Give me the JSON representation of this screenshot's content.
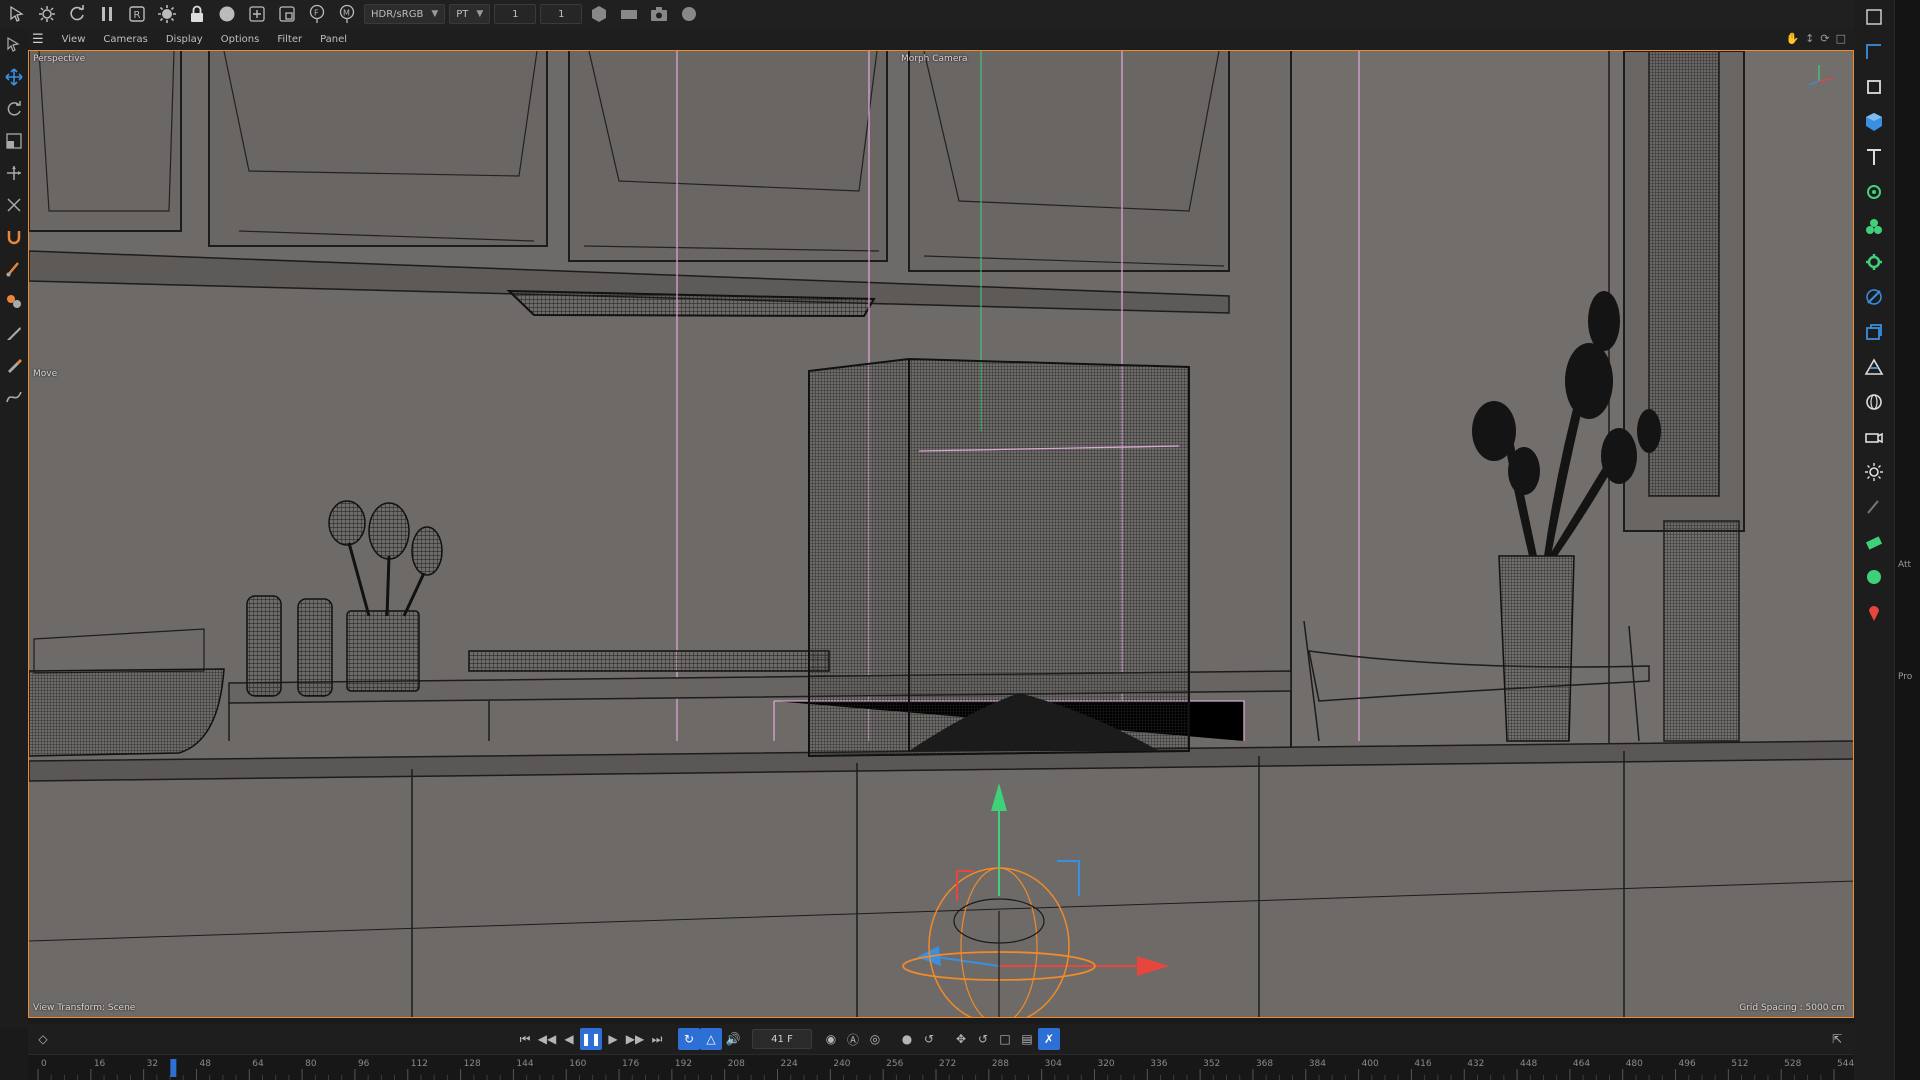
{
  "toolbar": {
    "color_space": "HDR/sRGB",
    "render_mode": "PT",
    "field_a": "1",
    "field_b": "1"
  },
  "viewport_menu": {
    "items": [
      "View",
      "Cameras",
      "Display",
      "Options",
      "Filter",
      "Panel"
    ]
  },
  "viewport": {
    "camera_label": "Perspective",
    "active_camera": "Morph Camera",
    "tool_label": "Move",
    "view_transform": "View Transform: Scene",
    "grid_spacing": "Grid Spacing : 5000 cm"
  },
  "timeline": {
    "current_frame": "41 F",
    "ticks": [
      "0",
      "16",
      "32",
      "48",
      "64",
      "80",
      "96",
      "112",
      "128",
      "144",
      "160",
      "176",
      "192",
      "208",
      "224",
      "240",
      "256",
      "272",
      "288",
      "304",
      "320",
      "336",
      "352",
      "368",
      "384",
      "400",
      "416",
      "432",
      "448",
      "464",
      "480",
      "496",
      "512",
      "528",
      "544"
    ],
    "playhead_frame": 41,
    "max_frame": 544
  },
  "right_strip": {
    "labels": [
      "Att",
      "Pro"
    ]
  },
  "colors": {
    "accent": "#2e6fd6",
    "selection": "#f08a2a",
    "gizmo_y": "#3fd17a",
    "gizmo_x": "#e8463c",
    "gizmo_z": "#3a8fe0"
  }
}
